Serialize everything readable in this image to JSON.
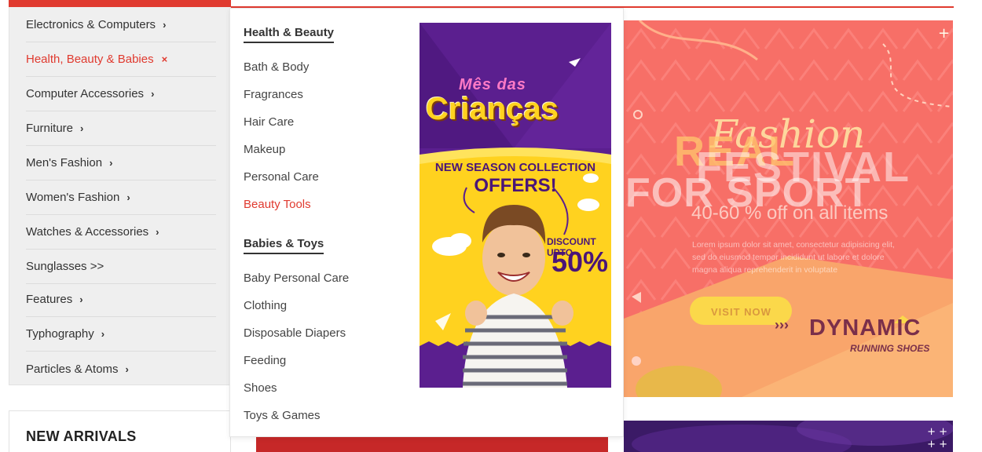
{
  "sidebar": {
    "items": [
      {
        "label": "Electronics & Computers",
        "marker": "›",
        "active": false
      },
      {
        "label": "Health, Beauty & Babies",
        "marker": "×",
        "active": true
      },
      {
        "label": "Computer Accessories",
        "marker": "›",
        "active": false
      },
      {
        "label": "Furniture",
        "marker": "›",
        "active": false
      },
      {
        "label": "Men's Fashion",
        "marker": "›",
        "active": false
      },
      {
        "label": "Women's Fashion",
        "marker": "›",
        "active": false
      },
      {
        "label": "Watches & Accessories",
        "marker": "›",
        "active": false
      },
      {
        "label": "Sunglasses >>",
        "marker": "",
        "active": false
      },
      {
        "label": "Features",
        "marker": "›",
        "active": false
      },
      {
        "label": "Typhography",
        "marker": "›",
        "active": false
      },
      {
        "label": "Particles & Atoms",
        "marker": "›",
        "active": false
      }
    ]
  },
  "new_arrivals": {
    "title": "NEW ARRIVALS"
  },
  "mega_menu": {
    "sections": [
      {
        "heading": "Health & Beauty",
        "links": [
          "Bath & Body",
          "Fragrances",
          "Hair Care",
          "Makeup",
          "Personal Care",
          "Beauty Tools"
        ],
        "active_link": "Beauty Tools"
      },
      {
        "heading": "Babies & Toys",
        "links": [
          "Baby Personal Care",
          "Clothing",
          "Disposable Diapers",
          "Feeding",
          "Shoes",
          "Toys & Games"
        ]
      }
    ],
    "promo": {
      "brand_line1": "Mês das",
      "brand_line2": "Crianças",
      "headline1": "NEW SEASON COLLECTION",
      "headline2": "OFFERS!",
      "discount_label": "DISCOUNT UPTO",
      "discount_value": "50%"
    }
  },
  "hero": {
    "script_title": "Fashion",
    "title_line1": "REAL",
    "title_line2": "FESTIVAL",
    "title_line3": "FOR SPORT",
    "offer": "40-60 % off on all items",
    "body_line1": "Lorem ipsum dolor sit amet, consectetur adipisicing elit,",
    "body_line2": "sed do eiusmod tempor incididunt ut labore et dolore",
    "body_line3": "magna aliqua reprehenderit in voluptate",
    "cta": "VISIT NOW",
    "brand": "DYNAMIC",
    "brand_sub": "RUNNING SHOES"
  },
  "colors": {
    "accent": "#e03a2f",
    "hero_bg": "#f76f67",
    "promo_purple": "#5b1f8f",
    "promo_yellow": "#ffd21f"
  }
}
